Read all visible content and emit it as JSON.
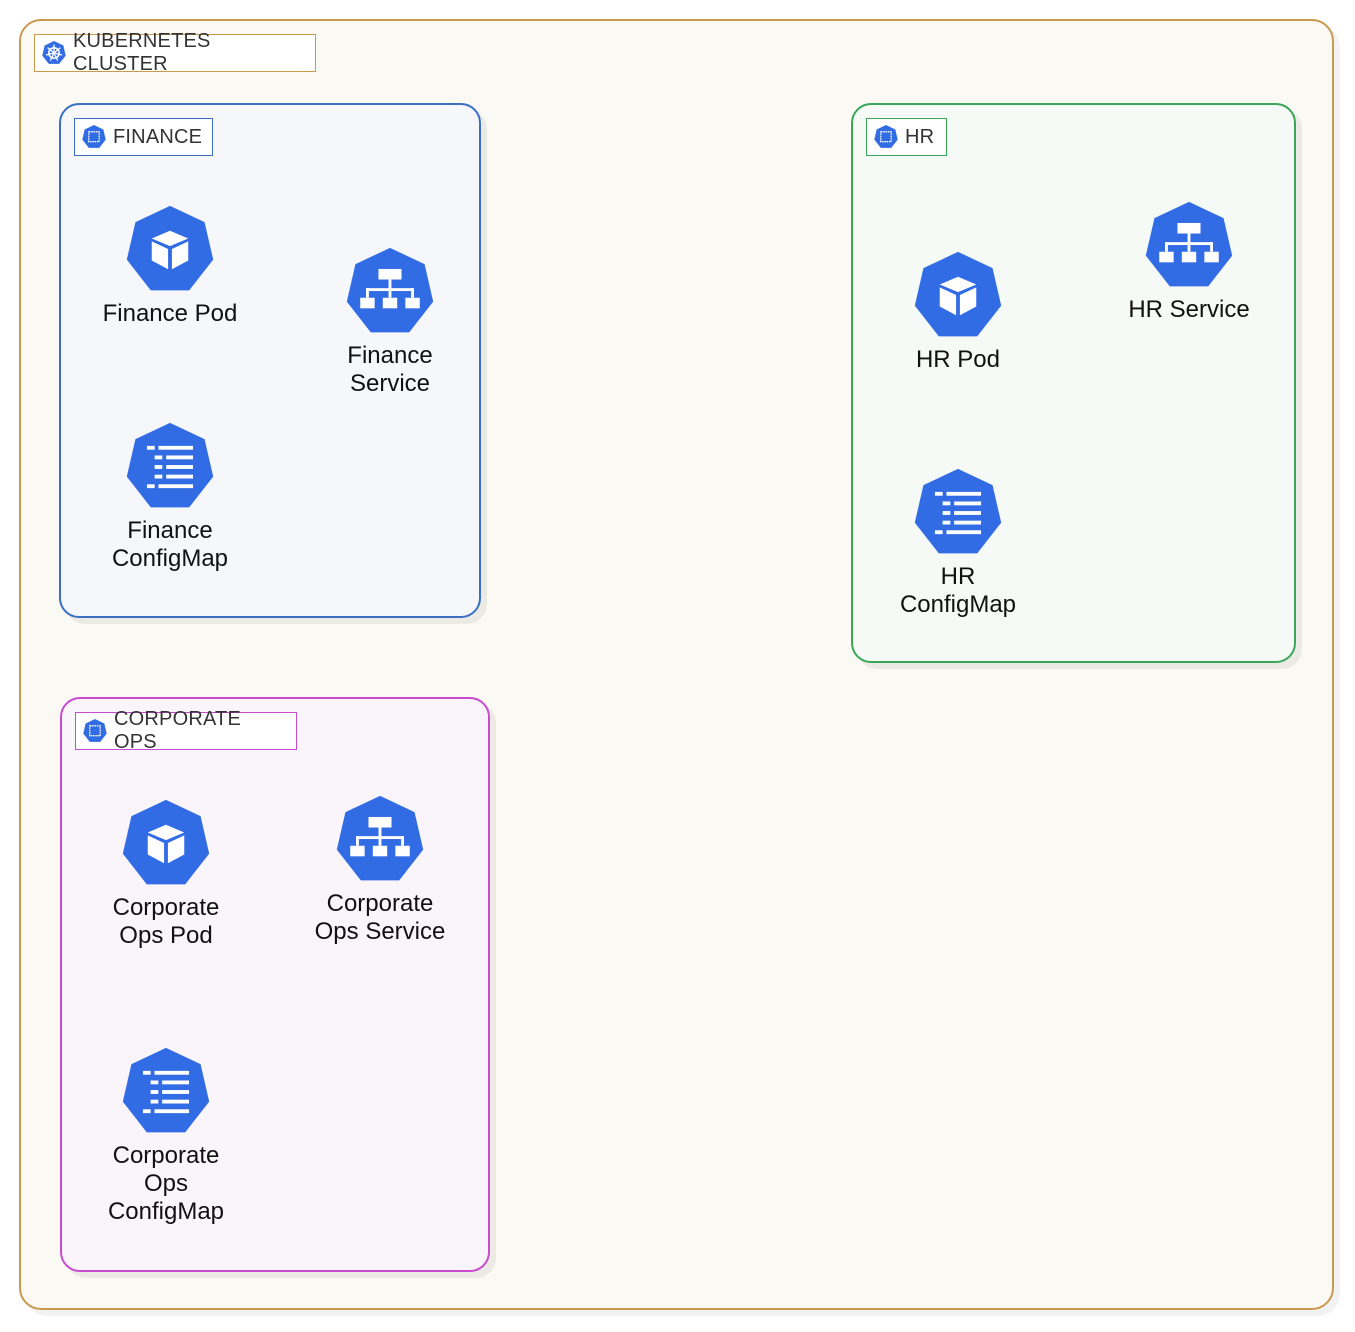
{
  "colors": {
    "kubernetes_blue": "#326ce5",
    "cluster_border": "#c99a4e",
    "finance_border": "#3a6fc4",
    "hr_border": "#3aa757",
    "corporate_ops_border": "#c84bd0"
  },
  "cluster": {
    "label": "KUBERNETES CLUSTER",
    "icon": "kubernetes-helm-icon"
  },
  "namespaces": {
    "finance": {
      "label": "FINANCE",
      "icon": "namespace-icon",
      "pod": {
        "label": "Finance Pod",
        "icon": "pod-cube-icon"
      },
      "service": {
        "label": "Finance\nService",
        "icon": "service-hierarchy-icon"
      },
      "configmap": {
        "label": "Finance\nConfigMap",
        "icon": "configmap-list-icon"
      }
    },
    "hr": {
      "label": "HR",
      "icon": "namespace-icon",
      "pod": {
        "label": "HR Pod",
        "icon": "pod-cube-icon"
      },
      "service": {
        "label": "HR Service",
        "icon": "service-hierarchy-icon"
      },
      "configmap": {
        "label": "HR\nConfigMap",
        "icon": "configmap-list-icon"
      }
    },
    "corporate_ops": {
      "label": "CORPORATE OPS",
      "icon": "namespace-icon",
      "pod": {
        "label": "Corporate\nOps Pod",
        "icon": "pod-cube-icon"
      },
      "service": {
        "label": "Corporate\nOps Service",
        "icon": "service-hierarchy-icon"
      },
      "configmap": {
        "label": "Corporate\nOps\nConfigMap",
        "icon": "configmap-list-icon"
      }
    }
  }
}
